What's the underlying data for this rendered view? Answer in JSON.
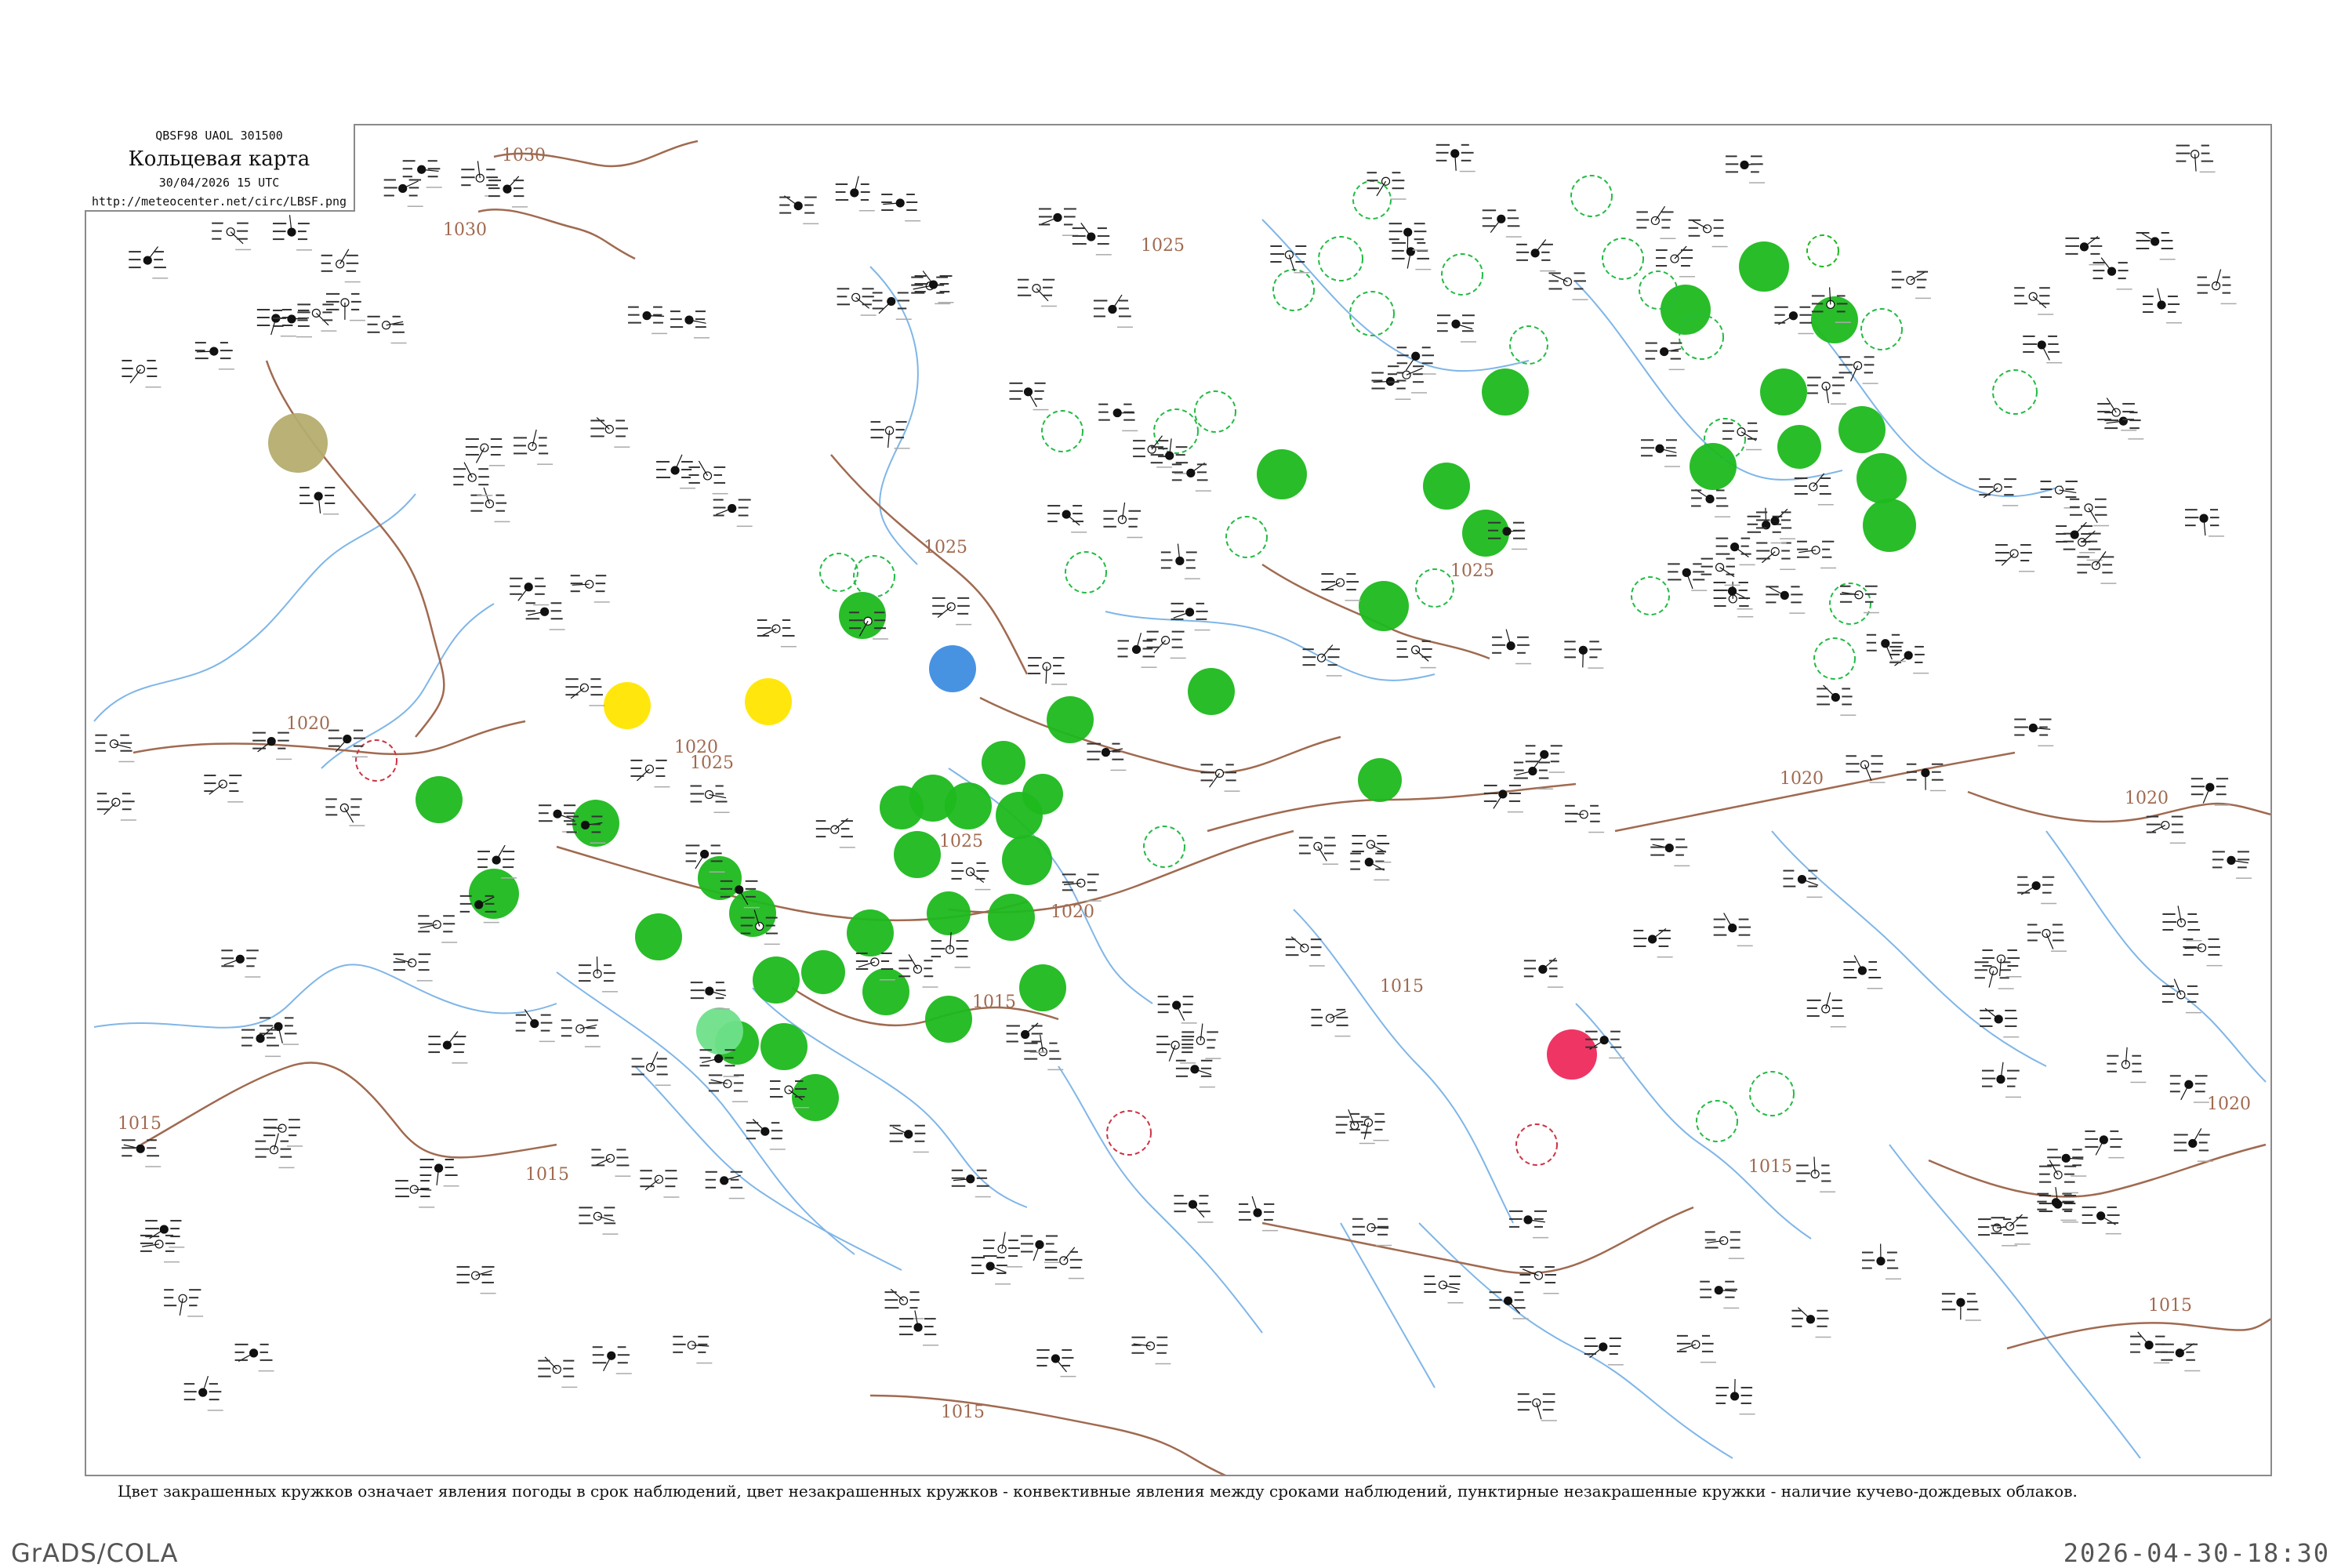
{
  "header": {
    "code": "QBSF98  UAOL  301500",
    "title": "Кольцевая карта",
    "datetime": "30/04/2026 15 UTC",
    "url": "http://meteocenter.net/circ/LBSF.png"
  },
  "caption": "Цвет закрашенных кружков означает явления погоды в срок наблюдений, цвет незакрашенных кружков - конвективные явления между сроками наблюдений, пунктирные незакрашенные кружки - наличие кучево-дождевых облаков.",
  "footer": {
    "left": "GrADS/COLA",
    "right": "2026-04-30-18:30"
  },
  "isobar_labels": [
    "1030",
    "1030",
    "1025",
    "1025",
    "1025",
    "1025",
    "1025",
    "1020",
    "1020",
    "1020",
    "1020",
    "1020",
    "1020",
    "1015",
    "1015",
    "1015",
    "1015",
    "1015",
    "1015",
    "1015"
  ],
  "colors": {
    "isobar": "#a06a50",
    "river": "#7fb6e8",
    "precip_green": "#1db91d",
    "shower_yellow": "#ffe600",
    "fog_olive": "#b5ad6e",
    "blue": "#3d8de0",
    "red": "#ee2a5c",
    "light_green": "#6fe08a",
    "cb_dashed": "#22bb44",
    "frame": "#8a8a8a"
  }
}
